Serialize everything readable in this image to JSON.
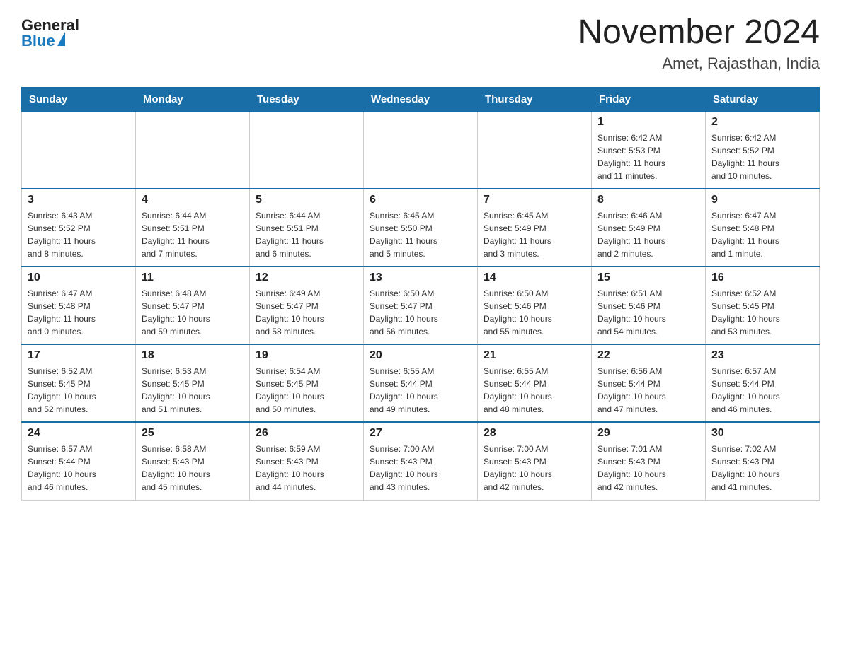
{
  "header": {
    "logo_general": "General",
    "logo_blue": "Blue",
    "month_year": "November 2024",
    "location": "Amet, Rajasthan, India"
  },
  "days_of_week": [
    "Sunday",
    "Monday",
    "Tuesday",
    "Wednesday",
    "Thursday",
    "Friday",
    "Saturday"
  ],
  "weeks": [
    [
      {
        "day": "",
        "info": ""
      },
      {
        "day": "",
        "info": ""
      },
      {
        "day": "",
        "info": ""
      },
      {
        "day": "",
        "info": ""
      },
      {
        "day": "",
        "info": ""
      },
      {
        "day": "1",
        "info": "Sunrise: 6:42 AM\nSunset: 5:53 PM\nDaylight: 11 hours\nand 11 minutes."
      },
      {
        "day": "2",
        "info": "Sunrise: 6:42 AM\nSunset: 5:52 PM\nDaylight: 11 hours\nand 10 minutes."
      }
    ],
    [
      {
        "day": "3",
        "info": "Sunrise: 6:43 AM\nSunset: 5:52 PM\nDaylight: 11 hours\nand 8 minutes."
      },
      {
        "day": "4",
        "info": "Sunrise: 6:44 AM\nSunset: 5:51 PM\nDaylight: 11 hours\nand 7 minutes."
      },
      {
        "day": "5",
        "info": "Sunrise: 6:44 AM\nSunset: 5:51 PM\nDaylight: 11 hours\nand 6 minutes."
      },
      {
        "day": "6",
        "info": "Sunrise: 6:45 AM\nSunset: 5:50 PM\nDaylight: 11 hours\nand 5 minutes."
      },
      {
        "day": "7",
        "info": "Sunrise: 6:45 AM\nSunset: 5:49 PM\nDaylight: 11 hours\nand 3 minutes."
      },
      {
        "day": "8",
        "info": "Sunrise: 6:46 AM\nSunset: 5:49 PM\nDaylight: 11 hours\nand 2 minutes."
      },
      {
        "day": "9",
        "info": "Sunrise: 6:47 AM\nSunset: 5:48 PM\nDaylight: 11 hours\nand 1 minute."
      }
    ],
    [
      {
        "day": "10",
        "info": "Sunrise: 6:47 AM\nSunset: 5:48 PM\nDaylight: 11 hours\nand 0 minutes."
      },
      {
        "day": "11",
        "info": "Sunrise: 6:48 AM\nSunset: 5:47 PM\nDaylight: 10 hours\nand 59 minutes."
      },
      {
        "day": "12",
        "info": "Sunrise: 6:49 AM\nSunset: 5:47 PM\nDaylight: 10 hours\nand 58 minutes."
      },
      {
        "day": "13",
        "info": "Sunrise: 6:50 AM\nSunset: 5:47 PM\nDaylight: 10 hours\nand 56 minutes."
      },
      {
        "day": "14",
        "info": "Sunrise: 6:50 AM\nSunset: 5:46 PM\nDaylight: 10 hours\nand 55 minutes."
      },
      {
        "day": "15",
        "info": "Sunrise: 6:51 AM\nSunset: 5:46 PM\nDaylight: 10 hours\nand 54 minutes."
      },
      {
        "day": "16",
        "info": "Sunrise: 6:52 AM\nSunset: 5:45 PM\nDaylight: 10 hours\nand 53 minutes."
      }
    ],
    [
      {
        "day": "17",
        "info": "Sunrise: 6:52 AM\nSunset: 5:45 PM\nDaylight: 10 hours\nand 52 minutes."
      },
      {
        "day": "18",
        "info": "Sunrise: 6:53 AM\nSunset: 5:45 PM\nDaylight: 10 hours\nand 51 minutes."
      },
      {
        "day": "19",
        "info": "Sunrise: 6:54 AM\nSunset: 5:45 PM\nDaylight: 10 hours\nand 50 minutes."
      },
      {
        "day": "20",
        "info": "Sunrise: 6:55 AM\nSunset: 5:44 PM\nDaylight: 10 hours\nand 49 minutes."
      },
      {
        "day": "21",
        "info": "Sunrise: 6:55 AM\nSunset: 5:44 PM\nDaylight: 10 hours\nand 48 minutes."
      },
      {
        "day": "22",
        "info": "Sunrise: 6:56 AM\nSunset: 5:44 PM\nDaylight: 10 hours\nand 47 minutes."
      },
      {
        "day": "23",
        "info": "Sunrise: 6:57 AM\nSunset: 5:44 PM\nDaylight: 10 hours\nand 46 minutes."
      }
    ],
    [
      {
        "day": "24",
        "info": "Sunrise: 6:57 AM\nSunset: 5:44 PM\nDaylight: 10 hours\nand 46 minutes."
      },
      {
        "day": "25",
        "info": "Sunrise: 6:58 AM\nSunset: 5:43 PM\nDaylight: 10 hours\nand 45 minutes."
      },
      {
        "day": "26",
        "info": "Sunrise: 6:59 AM\nSunset: 5:43 PM\nDaylight: 10 hours\nand 44 minutes."
      },
      {
        "day": "27",
        "info": "Sunrise: 7:00 AM\nSunset: 5:43 PM\nDaylight: 10 hours\nand 43 minutes."
      },
      {
        "day": "28",
        "info": "Sunrise: 7:00 AM\nSunset: 5:43 PM\nDaylight: 10 hours\nand 42 minutes."
      },
      {
        "day": "29",
        "info": "Sunrise: 7:01 AM\nSunset: 5:43 PM\nDaylight: 10 hours\nand 42 minutes."
      },
      {
        "day": "30",
        "info": "Sunrise: 7:02 AM\nSunset: 5:43 PM\nDaylight: 10 hours\nand 41 minutes."
      }
    ]
  ]
}
